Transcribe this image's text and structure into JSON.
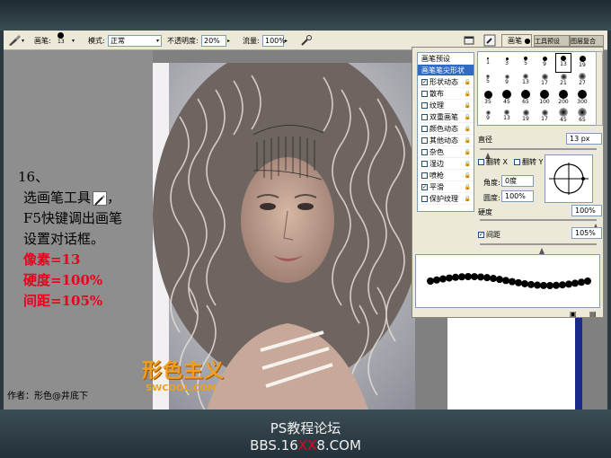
{
  "options_bar": {
    "brush_label": "画笔:",
    "brush_size": "13",
    "mode_label": "模式:",
    "mode_value": "正常",
    "opacity_label": "不透明度:",
    "opacity_value": "20%",
    "flow_label": "流量:",
    "flow_value": "100%"
  },
  "panel_tabs": [
    "画笔",
    "工具预设",
    "图层复合"
  ],
  "brush_panel": {
    "list": [
      {
        "label": "画笔预设",
        "type": "head"
      },
      {
        "label": "画笔笔尖形状",
        "type": "selected"
      },
      {
        "label": "形状动态",
        "checked": true
      },
      {
        "label": "散布",
        "checked": false
      },
      {
        "label": "纹理",
        "checked": false
      },
      {
        "label": "双重画笔",
        "checked": false
      },
      {
        "label": "颜色动态",
        "checked": false
      },
      {
        "label": "其他动态",
        "checked": false
      },
      {
        "label": "杂色",
        "checked": false
      },
      {
        "label": "湿边",
        "checked": false
      },
      {
        "label": "喷枪",
        "checked": false
      },
      {
        "label": "平滑",
        "checked": true
      },
      {
        "label": "保护纹理",
        "checked": false
      }
    ],
    "presets": [
      [
        "1",
        "3",
        "5",
        "9",
        "13",
        "19"
      ],
      [
        "5",
        "9",
        "13",
        "17",
        "21",
        "27"
      ],
      [
        "35",
        "45",
        "65",
        "100",
        "200",
        "300"
      ],
      [
        "9",
        "13",
        "19",
        "17",
        "45",
        "65"
      ]
    ],
    "selected_preset": "13",
    "diameter_label": "直径",
    "diameter_value": "13 px",
    "flip_x_label": "翻转 X",
    "flip_y_label": "翻转 Y",
    "angle_label": "角度:",
    "angle_value": "0度",
    "roundness_label": "圆度:",
    "roundness_value": "100%",
    "hardness_label": "硬度",
    "hardness_value": "100%",
    "spacing_label": "间距",
    "spacing_value": "105%",
    "spacing_checked": true
  },
  "tutorial": {
    "step": "16、",
    "line1": "选画笔工具",
    "line2": "F5快键调出画笔",
    "line3": "设置对话框。",
    "pixel": "像素=13",
    "hardness": "硬度=100%",
    "spacing": "间距=105%"
  },
  "author": "作者：形色@井底下",
  "watermark": {
    "title": "形色主义",
    "url": "SWCOOL.COM"
  },
  "footer": {
    "line1": "PS教程论坛",
    "line2_a": "BBS.16",
    "line2_b": "XX",
    "line2_c": "8.COM"
  },
  "colors": {
    "accent_red": "#e8001c",
    "selection_blue": "#316ac5"
  }
}
